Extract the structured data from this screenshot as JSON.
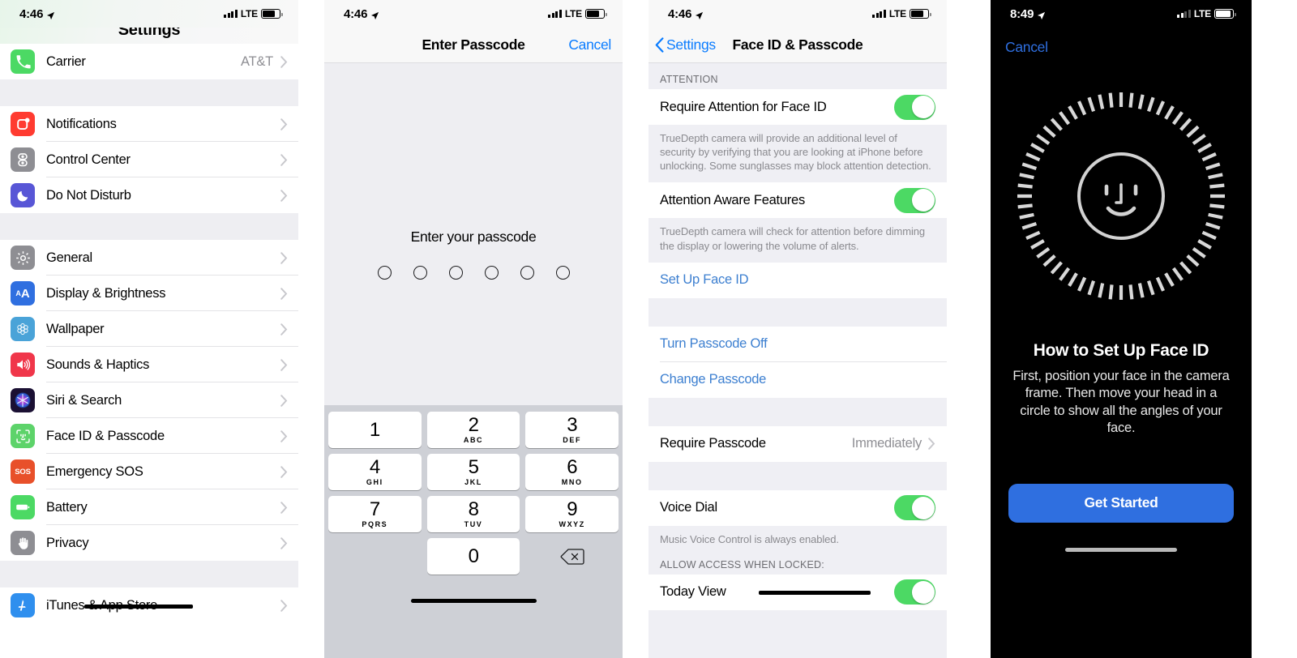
{
  "panels": {
    "settings": {
      "statusbar": {
        "time": "4:46",
        "carrier_tech": "LTE",
        "location_icon": "location-arrow-icon"
      },
      "title": "Settings",
      "groups": [
        {
          "rows": [
            {
              "label": "Carrier",
              "value": "AT&T",
              "icon": "phone-icon",
              "icon_color": "#4cd964"
            }
          ]
        },
        {
          "rows": [
            {
              "label": "Notifications",
              "value": "",
              "icon": "notifications-icon",
              "icon_color": "#ff3b30"
            },
            {
              "label": "Control Center",
              "value": "",
              "icon": "control-center-icon",
              "icon_color": "#8e8e93"
            },
            {
              "label": "Do Not Disturb",
              "value": "",
              "icon": "moon-icon",
              "icon_color": "#5856d6"
            }
          ]
        },
        {
          "rows": [
            {
              "label": "General",
              "value": "",
              "icon": "gear-icon",
              "icon_color": "#8e8e93"
            },
            {
              "label": "Display & Brightness",
              "value": "",
              "icon": "display-brightness-icon",
              "icon_color": "#2f6fe0"
            },
            {
              "label": "Wallpaper",
              "value": "",
              "icon": "wallpaper-icon",
              "icon_color": "#4aa3d8"
            },
            {
              "label": "Sounds & Haptics",
              "value": "",
              "icon": "speaker-icon",
              "icon_color": "#f0364a"
            },
            {
              "label": "Siri & Search",
              "value": "",
              "icon": "siri-icon",
              "icon_color": "#1b1033"
            },
            {
              "label": "Face ID & Passcode",
              "value": "",
              "icon": "face-id-icon",
              "icon_color": "#5dd36a"
            },
            {
              "label": "Emergency SOS",
              "value": "",
              "icon": "sos-icon",
              "icon_color": "#e8502a"
            },
            {
              "label": "Battery",
              "value": "",
              "icon": "battery-icon",
              "icon_color": "#4cd964"
            },
            {
              "label": "Privacy",
              "value": "",
              "icon": "hand-icon",
              "icon_color": "#8e8e93"
            }
          ]
        },
        {
          "rows": [
            {
              "label": "iTunes & App Store",
              "value": "",
              "icon": "app-store-icon",
              "icon_color": "#2f8fee"
            }
          ]
        }
      ]
    },
    "passcode": {
      "statusbar": {
        "time": "4:46",
        "carrier_tech": "LTE"
      },
      "nav_title": "Enter Passcode",
      "cancel_label": "Cancel",
      "prompt": "Enter your passcode",
      "dot_count": 6,
      "keys": [
        {
          "num": "1",
          "letters": ""
        },
        {
          "num": "2",
          "letters": "ABC"
        },
        {
          "num": "3",
          "letters": "DEF"
        },
        {
          "num": "4",
          "letters": "GHI"
        },
        {
          "num": "5",
          "letters": "JKL"
        },
        {
          "num": "6",
          "letters": "MNO"
        },
        {
          "num": "7",
          "letters": "PQRS"
        },
        {
          "num": "8",
          "letters": "TUV"
        },
        {
          "num": "9",
          "letters": "WXYZ"
        },
        {
          "num": "0",
          "letters": ""
        }
      ],
      "delete_icon": "delete-backspace-icon"
    },
    "faceid_settings": {
      "statusbar": {
        "time": "4:46",
        "carrier_tech": "LTE"
      },
      "back_label": "Settings",
      "nav_title": "Face ID & Passcode",
      "section_attention_header": "ATTENTION",
      "require_attention": {
        "label": "Require Attention for Face ID",
        "toggle": "on"
      },
      "require_attention_footer": "TrueDepth camera will provide an additional level of security by verifying that you are looking at iPhone before unlocking. Some sunglasses may block attention detection.",
      "attention_aware": {
        "label": "Attention Aware Features",
        "toggle": "on"
      },
      "attention_aware_footer": "TrueDepth camera will check for attention before dimming the display or lowering the volume of alerts.",
      "set_up_face_id": "Set Up Face ID",
      "turn_passcode_off": "Turn Passcode Off",
      "change_passcode": "Change Passcode",
      "require_passcode": {
        "label": "Require Passcode",
        "value": "Immediately"
      },
      "voice_dial": {
        "label": "Voice Dial",
        "toggle": "on"
      },
      "voice_dial_footer": "Music Voice Control is always enabled.",
      "allow_access_header": "ALLOW ACCESS WHEN LOCKED:",
      "today_view": {
        "label": "Today View",
        "toggle": "on"
      }
    },
    "faceid_setup": {
      "statusbar": {
        "time": "8:49",
        "carrier_tech": "LTE"
      },
      "cancel_label": "Cancel",
      "graphic": "face-id-dial-icon",
      "title": "How to Set Up Face ID",
      "subtitle": "First, position your face in the camera frame. Then move your head in a circle to show all the angles of your face.",
      "button_label": "Get Started",
      "button_color": "#2f6fe0"
    }
  }
}
